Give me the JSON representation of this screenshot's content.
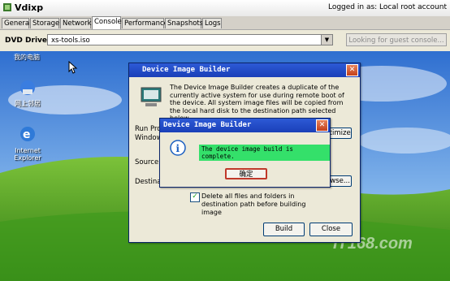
{
  "app": {
    "title": "Vdixp",
    "login_status": "Logged in as: Local root account"
  },
  "tabs": [
    {
      "label": "General",
      "active": false
    },
    {
      "label": "Storage",
      "active": false
    },
    {
      "label": "Network",
      "active": false
    },
    {
      "label": "Console",
      "active": true
    },
    {
      "label": "Performance",
      "active": false
    },
    {
      "label": "Snapshots",
      "active": false
    },
    {
      "label": "Logs",
      "active": false
    }
  ],
  "toolbar": {
    "dvd_label": "DVD Drive:",
    "dvd_value": "xs-tools.iso",
    "guest_button": "Looking for guest console..."
  },
  "desktop": {
    "icons": [
      {
        "label": "我的电脑"
      },
      {
        "label": "网上邻居"
      },
      {
        "label": "Internet Explorer"
      }
    ],
    "watermark": "IT168.com"
  },
  "builder": {
    "title": "Device Image Builder",
    "description": "The Device Image Builder creates a duplicate of the currently active system for use during remote boot of the device.  All system image files will be copied from the local hard disk to the destination path selected below.",
    "run_label": "Run Pro",
    "windows_label": "Window",
    "optimize_label": "ptimize",
    "source_label": "Source",
    "dest_label": "Destinat",
    "browse_label": "owse...",
    "delete_checkbox": "Delete all files and folders in destination path before building image",
    "build_button": "Build",
    "close_button": "Close"
  },
  "dialog": {
    "title": "Device Image Builder",
    "message": "The device image build is complete.",
    "ok_button": "确定"
  }
}
